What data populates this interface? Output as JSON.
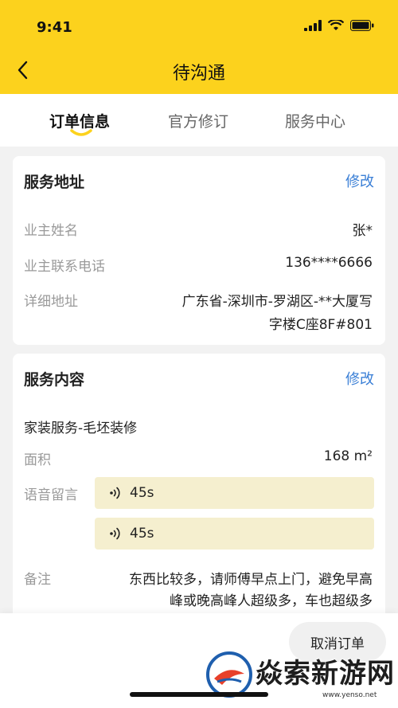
{
  "status_bar": {
    "time": "9:41"
  },
  "nav": {
    "title": "待沟通"
  },
  "tabs": [
    {
      "label": "订单信息",
      "active": true
    },
    {
      "label": "官方修订",
      "active": false
    },
    {
      "label": "服务中心",
      "active": false
    }
  ],
  "address_card": {
    "title": "服务地址",
    "action": "修改",
    "rows": [
      {
        "label": "业主姓名",
        "value": "张*"
      },
      {
        "label": "业主联系电话",
        "value": "136****6666"
      },
      {
        "label": "详细地址",
        "value_line1": "广东省-深圳市-罗湖区-**大厦写",
        "value_line2": "字楼C座8F#801"
      }
    ]
  },
  "service_card": {
    "title": "服务内容",
    "action": "修改",
    "service_type": "家装服务-毛坯装修",
    "area_label": "面积",
    "area_value": "168 m²",
    "voice_label": "语音留言",
    "voice_messages": [
      {
        "duration": "45s"
      },
      {
        "duration": "45s"
      }
    ],
    "note_label": "备注",
    "note_line1": "东西比较多，请师傅早点上门，避免早高",
    "note_line2": "峰或晚高峰人超级多，车也超级多"
  },
  "footer": {
    "cancel_button": "取消订单"
  },
  "watermark": {
    "text": "焱索新游网",
    "url": "www.yenso.net"
  },
  "colors": {
    "brand_yellow": "#fcd21d",
    "link_blue": "#3a7fd6",
    "voice_bg": "#f5efcf"
  }
}
